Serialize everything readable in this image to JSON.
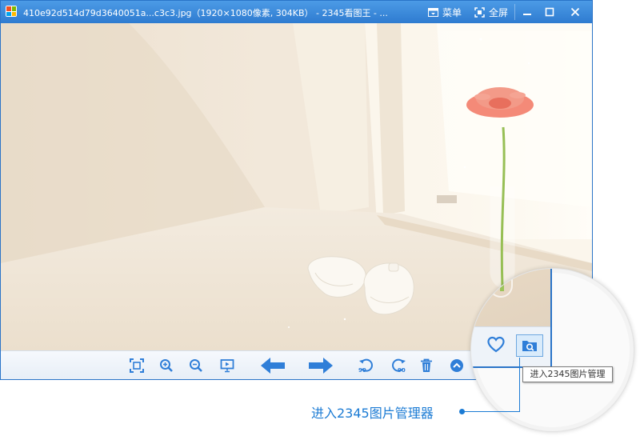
{
  "window": {
    "title": "410e92d514d79d3640051a...c3c3.jpg（1920×1080像素, 304KB） - 2345看图王 - ...",
    "menu_label": "菜单",
    "fullscreen_label": "全屏"
  },
  "colors": {
    "titlebar": "#3a88dc",
    "accent": "#1b7bd4",
    "icon_blue": "#2f7ed8"
  },
  "toolbar": {
    "rotate_left_label": "90",
    "rotate_right_label": "90"
  },
  "icons": {
    "fit": "fit-window-icon",
    "zoom_in": "zoom-in-icon",
    "zoom_out": "zoom-out-icon",
    "slideshow": "slideshow-icon",
    "prev": "arrow-left-icon",
    "next": "arrow-right-icon",
    "rotate_left": "rotate-left-icon",
    "rotate_right": "rotate-right-icon",
    "delete": "trash-icon",
    "more": "chevron-up-circle-icon",
    "favorite": "heart-icon",
    "manager": "folder-search-icon"
  },
  "tooltip": {
    "text": "进入2345图片管理"
  },
  "callout": {
    "text": "进入2345图片管理器"
  }
}
